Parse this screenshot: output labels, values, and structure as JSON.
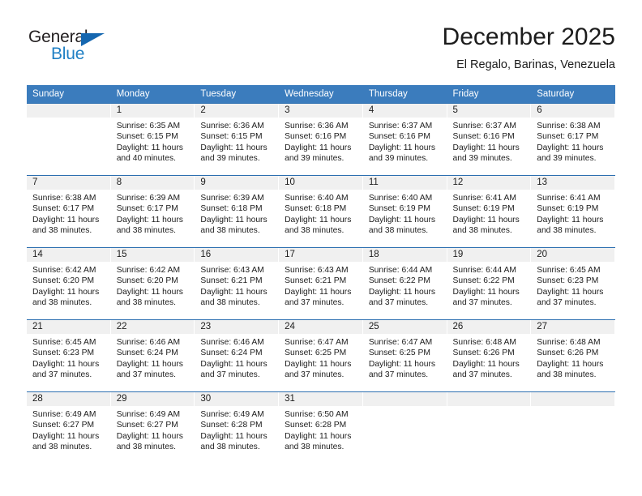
{
  "brand": {
    "name_top": "General",
    "name_bottom": "Blue",
    "triangle_color": "#1567b0",
    "top_color": "#231f20",
    "bottom_color": "#1f7fc4"
  },
  "header": {
    "title": "December 2025",
    "subtitle": "El Regalo, Barinas, Venezuela"
  },
  "theme": {
    "header_bg": "#3b7cbd",
    "week_divider": "#2c6fb0",
    "daynum_bg": "#f0f0f0"
  },
  "weekdays": [
    "Sunday",
    "Monday",
    "Tuesday",
    "Wednesday",
    "Thursday",
    "Friday",
    "Saturday"
  ],
  "weeks": [
    [
      {
        "day": "",
        "sunrise": "",
        "sunset": "",
        "daylight_1": "",
        "daylight_2": ""
      },
      {
        "day": "1",
        "sunrise": "Sunrise: 6:35 AM",
        "sunset": "Sunset: 6:15 PM",
        "daylight_1": "Daylight: 11 hours",
        "daylight_2": "and 40 minutes."
      },
      {
        "day": "2",
        "sunrise": "Sunrise: 6:36 AM",
        "sunset": "Sunset: 6:15 PM",
        "daylight_1": "Daylight: 11 hours",
        "daylight_2": "and 39 minutes."
      },
      {
        "day": "3",
        "sunrise": "Sunrise: 6:36 AM",
        "sunset": "Sunset: 6:16 PM",
        "daylight_1": "Daylight: 11 hours",
        "daylight_2": "and 39 minutes."
      },
      {
        "day": "4",
        "sunrise": "Sunrise: 6:37 AM",
        "sunset": "Sunset: 6:16 PM",
        "daylight_1": "Daylight: 11 hours",
        "daylight_2": "and 39 minutes."
      },
      {
        "day": "5",
        "sunrise": "Sunrise: 6:37 AM",
        "sunset": "Sunset: 6:16 PM",
        "daylight_1": "Daylight: 11 hours",
        "daylight_2": "and 39 minutes."
      },
      {
        "day": "6",
        "sunrise": "Sunrise: 6:38 AM",
        "sunset": "Sunset: 6:17 PM",
        "daylight_1": "Daylight: 11 hours",
        "daylight_2": "and 39 minutes."
      }
    ],
    [
      {
        "day": "7",
        "sunrise": "Sunrise: 6:38 AM",
        "sunset": "Sunset: 6:17 PM",
        "daylight_1": "Daylight: 11 hours",
        "daylight_2": "and 38 minutes."
      },
      {
        "day": "8",
        "sunrise": "Sunrise: 6:39 AM",
        "sunset": "Sunset: 6:17 PM",
        "daylight_1": "Daylight: 11 hours",
        "daylight_2": "and 38 minutes."
      },
      {
        "day": "9",
        "sunrise": "Sunrise: 6:39 AM",
        "sunset": "Sunset: 6:18 PM",
        "daylight_1": "Daylight: 11 hours",
        "daylight_2": "and 38 minutes."
      },
      {
        "day": "10",
        "sunrise": "Sunrise: 6:40 AM",
        "sunset": "Sunset: 6:18 PM",
        "daylight_1": "Daylight: 11 hours",
        "daylight_2": "and 38 minutes."
      },
      {
        "day": "11",
        "sunrise": "Sunrise: 6:40 AM",
        "sunset": "Sunset: 6:19 PM",
        "daylight_1": "Daylight: 11 hours",
        "daylight_2": "and 38 minutes."
      },
      {
        "day": "12",
        "sunrise": "Sunrise: 6:41 AM",
        "sunset": "Sunset: 6:19 PM",
        "daylight_1": "Daylight: 11 hours",
        "daylight_2": "and 38 minutes."
      },
      {
        "day": "13",
        "sunrise": "Sunrise: 6:41 AM",
        "sunset": "Sunset: 6:19 PM",
        "daylight_1": "Daylight: 11 hours",
        "daylight_2": "and 38 minutes."
      }
    ],
    [
      {
        "day": "14",
        "sunrise": "Sunrise: 6:42 AM",
        "sunset": "Sunset: 6:20 PM",
        "daylight_1": "Daylight: 11 hours",
        "daylight_2": "and 38 minutes."
      },
      {
        "day": "15",
        "sunrise": "Sunrise: 6:42 AM",
        "sunset": "Sunset: 6:20 PM",
        "daylight_1": "Daylight: 11 hours",
        "daylight_2": "and 38 minutes."
      },
      {
        "day": "16",
        "sunrise": "Sunrise: 6:43 AM",
        "sunset": "Sunset: 6:21 PM",
        "daylight_1": "Daylight: 11 hours",
        "daylight_2": "and 38 minutes."
      },
      {
        "day": "17",
        "sunrise": "Sunrise: 6:43 AM",
        "sunset": "Sunset: 6:21 PM",
        "daylight_1": "Daylight: 11 hours",
        "daylight_2": "and 37 minutes."
      },
      {
        "day": "18",
        "sunrise": "Sunrise: 6:44 AM",
        "sunset": "Sunset: 6:22 PM",
        "daylight_1": "Daylight: 11 hours",
        "daylight_2": "and 37 minutes."
      },
      {
        "day": "19",
        "sunrise": "Sunrise: 6:44 AM",
        "sunset": "Sunset: 6:22 PM",
        "daylight_1": "Daylight: 11 hours",
        "daylight_2": "and 37 minutes."
      },
      {
        "day": "20",
        "sunrise": "Sunrise: 6:45 AM",
        "sunset": "Sunset: 6:23 PM",
        "daylight_1": "Daylight: 11 hours",
        "daylight_2": "and 37 minutes."
      }
    ],
    [
      {
        "day": "21",
        "sunrise": "Sunrise: 6:45 AM",
        "sunset": "Sunset: 6:23 PM",
        "daylight_1": "Daylight: 11 hours",
        "daylight_2": "and 37 minutes."
      },
      {
        "day": "22",
        "sunrise": "Sunrise: 6:46 AM",
        "sunset": "Sunset: 6:24 PM",
        "daylight_1": "Daylight: 11 hours",
        "daylight_2": "and 37 minutes."
      },
      {
        "day": "23",
        "sunrise": "Sunrise: 6:46 AM",
        "sunset": "Sunset: 6:24 PM",
        "daylight_1": "Daylight: 11 hours",
        "daylight_2": "and 37 minutes."
      },
      {
        "day": "24",
        "sunrise": "Sunrise: 6:47 AM",
        "sunset": "Sunset: 6:25 PM",
        "daylight_1": "Daylight: 11 hours",
        "daylight_2": "and 37 minutes."
      },
      {
        "day": "25",
        "sunrise": "Sunrise: 6:47 AM",
        "sunset": "Sunset: 6:25 PM",
        "daylight_1": "Daylight: 11 hours",
        "daylight_2": "and 37 minutes."
      },
      {
        "day": "26",
        "sunrise": "Sunrise: 6:48 AM",
        "sunset": "Sunset: 6:26 PM",
        "daylight_1": "Daylight: 11 hours",
        "daylight_2": "and 37 minutes."
      },
      {
        "day": "27",
        "sunrise": "Sunrise: 6:48 AM",
        "sunset": "Sunset: 6:26 PM",
        "daylight_1": "Daylight: 11 hours",
        "daylight_2": "and 38 minutes."
      }
    ],
    [
      {
        "day": "28",
        "sunrise": "Sunrise: 6:49 AM",
        "sunset": "Sunset: 6:27 PM",
        "daylight_1": "Daylight: 11 hours",
        "daylight_2": "and 38 minutes."
      },
      {
        "day": "29",
        "sunrise": "Sunrise: 6:49 AM",
        "sunset": "Sunset: 6:27 PM",
        "daylight_1": "Daylight: 11 hours",
        "daylight_2": "and 38 minutes."
      },
      {
        "day": "30",
        "sunrise": "Sunrise: 6:49 AM",
        "sunset": "Sunset: 6:28 PM",
        "daylight_1": "Daylight: 11 hours",
        "daylight_2": "and 38 minutes."
      },
      {
        "day": "31",
        "sunrise": "Sunrise: 6:50 AM",
        "sunset": "Sunset: 6:28 PM",
        "daylight_1": "Daylight: 11 hours",
        "daylight_2": "and 38 minutes."
      },
      {
        "day": "",
        "sunrise": "",
        "sunset": "",
        "daylight_1": "",
        "daylight_2": ""
      },
      {
        "day": "",
        "sunrise": "",
        "sunset": "",
        "daylight_1": "",
        "daylight_2": ""
      },
      {
        "day": "",
        "sunrise": "",
        "sunset": "",
        "daylight_1": "",
        "daylight_2": ""
      }
    ]
  ]
}
